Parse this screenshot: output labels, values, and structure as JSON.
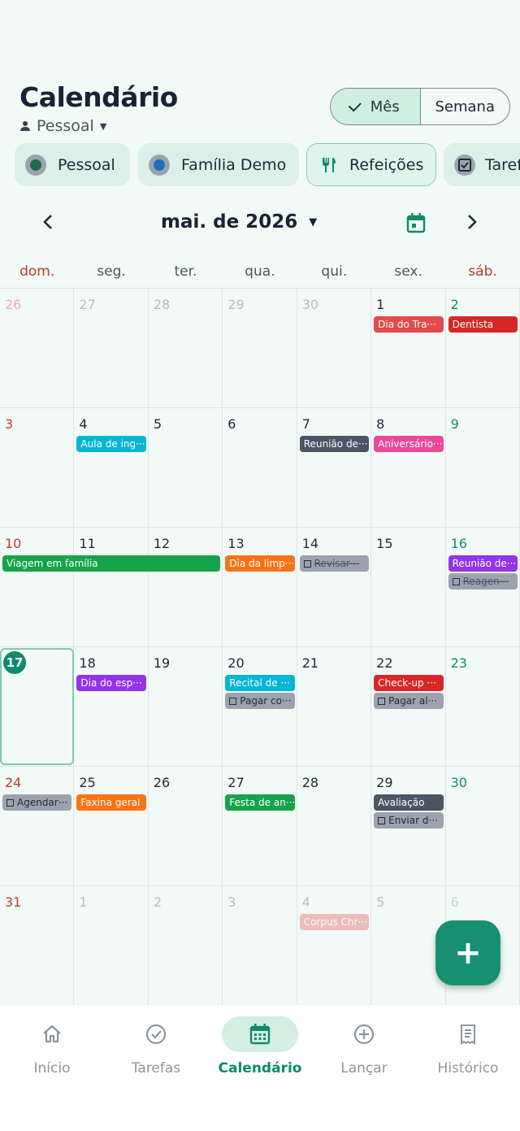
{
  "header": {
    "title": "Calendário",
    "profile": "Pessoal"
  },
  "view_toggle": {
    "month_label": "Mês",
    "week_label": "Semana",
    "selected": "Mês"
  },
  "filter_chips": [
    {
      "label": "Pessoal",
      "color": "#1f6b4f",
      "icon": "circle-check-icon"
    },
    {
      "label": "Família Demo",
      "color": "#1d6fb8",
      "icon": "circle-check-icon"
    },
    {
      "label": "Refeições",
      "color": "#0f8a6a",
      "icon": "fork-knife-icon"
    },
    {
      "label": "Tarefas",
      "color": "#374151",
      "icon": "checkbox-icon"
    }
  ],
  "month_nav": {
    "label": "mai. de 2026"
  },
  "weekdays": [
    "dom.",
    "seg.",
    "ter.",
    "qua.",
    "qui.",
    "sex.",
    "sáb."
  ],
  "weeks": [
    [
      "26",
      "27",
      "28",
      "29",
      "30",
      "1",
      "2"
    ],
    [
      "3",
      "4",
      "5",
      "6",
      "7",
      "8",
      "9"
    ],
    [
      "10",
      "11",
      "12",
      "13",
      "14",
      "15",
      "16"
    ],
    [
      "17",
      "18",
      "19",
      "20",
      "21",
      "22",
      "23"
    ],
    [
      "24",
      "25",
      "26",
      "27",
      "28",
      "29",
      "30"
    ],
    [
      "31",
      "1",
      "2",
      "3",
      "4",
      "5",
      "6"
    ]
  ],
  "today": "17",
  "events": [
    {
      "label": "Dia do Tra···",
      "week": 0,
      "day": 5,
      "span": 1,
      "row": 0,
      "color": "#e14b4b",
      "kind": "event"
    },
    {
      "label": "Dentista",
      "week": 0,
      "day": 6,
      "span": 1,
      "row": 0,
      "color": "#d62828",
      "kind": "event"
    },
    {
      "label": "Aula de ing···",
      "week": 1,
      "day": 1,
      "span": 1,
      "row": 0,
      "color": "#06b6d4",
      "kind": "event"
    },
    {
      "label": "Reunião de···",
      "week": 1,
      "day": 4,
      "span": 1,
      "row": 0,
      "color": "#4b5563",
      "kind": "event"
    },
    {
      "label": "Aniversário···",
      "week": 1,
      "day": 5,
      "span": 1,
      "row": 0,
      "color": "#ec4899",
      "kind": "event"
    },
    {
      "label": "Viagem em família",
      "week": 2,
      "day": 0,
      "span": 3,
      "row": 0,
      "color": "#16a34a",
      "kind": "event"
    },
    {
      "label": "Dia da limp···",
      "week": 2,
      "day": 3,
      "span": 1,
      "row": 0,
      "color": "#f97316",
      "kind": "event"
    },
    {
      "label": "Revisar···",
      "week": 2,
      "day": 4,
      "span": 1,
      "row": 0,
      "color": "#9ca3af",
      "kind": "task-done"
    },
    {
      "label": "Reunião de···",
      "week": 2,
      "day": 6,
      "span": 1,
      "row": 0,
      "color": "#9333ea",
      "kind": "event"
    },
    {
      "label": "Reagen···",
      "week": 2,
      "day": 6,
      "span": 1,
      "row": 1,
      "color": "#9ca3af",
      "kind": "task-done"
    },
    {
      "label": "Dia do esp···",
      "week": 3,
      "day": 1,
      "span": 1,
      "row": 0,
      "color": "#9333ea",
      "kind": "event"
    },
    {
      "label": "Recital de ···",
      "week": 3,
      "day": 3,
      "span": 1,
      "row": 0,
      "color": "#06b6d4",
      "kind": "event"
    },
    {
      "label": "Pagar co···",
      "week": 3,
      "day": 3,
      "span": 1,
      "row": 1,
      "color": "#9ca3af",
      "kind": "task"
    },
    {
      "label": "Check-up ···",
      "week": 3,
      "day": 5,
      "span": 1,
      "row": 0,
      "color": "#d62828",
      "kind": "event"
    },
    {
      "label": "Pagar al···",
      "week": 3,
      "day": 5,
      "span": 1,
      "row": 1,
      "color": "#9ca3af",
      "kind": "task"
    },
    {
      "label": "Agendar···",
      "week": 4,
      "day": 0,
      "span": 1,
      "row": 0,
      "color": "#9ca3af",
      "kind": "task"
    },
    {
      "label": "Faxina geral",
      "week": 4,
      "day": 1,
      "span": 1,
      "row": 0,
      "color": "#f97316",
      "kind": "event"
    },
    {
      "label": "Festa de an···",
      "week": 4,
      "day": 3,
      "span": 1,
      "row": 0,
      "color": "#16a34a",
      "kind": "event"
    },
    {
      "label": "Avaliação",
      "week": 4,
      "day": 5,
      "span": 1,
      "row": 0,
      "color": "#4b5563",
      "kind": "event"
    },
    {
      "label": "Enviar d···",
      "week": 4,
      "day": 5,
      "span": 1,
      "row": 1,
      "color": "#9ca3af",
      "kind": "task"
    },
    {
      "label": "Corpus Chr···",
      "week": 5,
      "day": 4,
      "span": 1,
      "row": 0,
      "color": "#e14b4b",
      "kind": "event-faded"
    }
  ],
  "fab": {
    "label": "+"
  },
  "bottom_nav": [
    {
      "label": "Início",
      "icon": "home-icon",
      "active": false
    },
    {
      "label": "Tarefas",
      "icon": "check-circle-icon",
      "active": false
    },
    {
      "label": "Calendário",
      "icon": "calendar-icon",
      "active": true
    },
    {
      "label": "Lançar",
      "icon": "plus-circle-icon",
      "active": false
    },
    {
      "label": "Histórico",
      "icon": "receipt-icon",
      "active": false
    }
  ]
}
